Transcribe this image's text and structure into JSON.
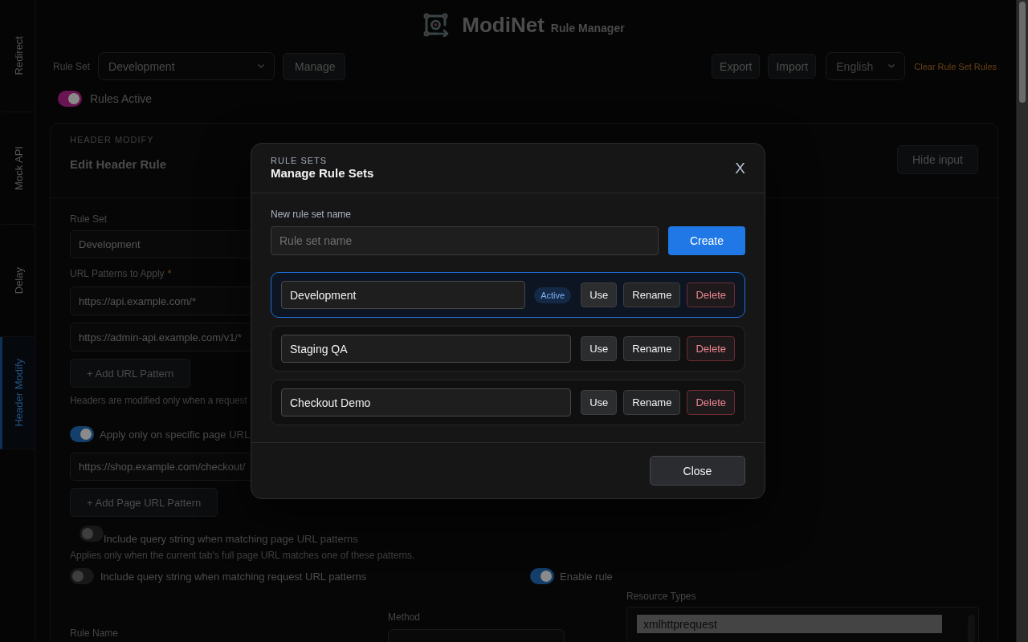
{
  "sidebar": {
    "tabs": [
      {
        "label": "Redirect",
        "selected": false
      },
      {
        "label": "Mock API",
        "selected": false
      },
      {
        "label": "Delay",
        "selected": false
      },
      {
        "label": "Header Modify",
        "selected": true
      }
    ]
  },
  "brand": {
    "title": "ModiNet",
    "subtitle": "Rule Manager"
  },
  "toolbar": {
    "rule_set_label": "Rule Set",
    "rule_set": "Development",
    "manage_button": "Manage",
    "export_button": "Export",
    "import_button": "Import",
    "language": "English",
    "clear_link": "Clear Rule Set Rules"
  },
  "rules_active": {
    "label": "Rules Active",
    "on": true
  },
  "editor": {
    "eyebrow": "HEADER MODIFY",
    "title": "Edit Header Rule",
    "hide_button": "Hide input",
    "rule_set": {
      "label": "Rule Set",
      "value": "Development"
    },
    "url_patterns": {
      "label": "URL Patterns to Apply",
      "required_mark": "*",
      "values": [
        "https://api.example.com/*",
        "https://admin-api.example.com/v1/*"
      ],
      "add_button": "+ Add URL Pattern",
      "note": "Headers are modified only when a request"
    },
    "page_filter": {
      "label": "Apply only on specific page URL",
      "on": true,
      "values": [
        "https://shop.example.com/checkout/"
      ],
      "add_button": "+ Add Page URL Pattern"
    },
    "page_query": {
      "label": "Include query string when matching page URL patterns",
      "on": false,
      "note": "Applies only when the current tab's full page URL matches one of these patterns."
    },
    "request_query": {
      "label": "Include query string when matching request URL patterns",
      "on": false
    },
    "enable_rule": {
      "label": "Enable rule",
      "on": true
    },
    "rule_name": {
      "label": "Rule Name"
    },
    "method": {
      "label": "Method"
    },
    "resource_types": {
      "label": "Resource Types",
      "options": [
        {
          "label": "xmlhttprequest",
          "selected": true
        }
      ]
    }
  },
  "modal": {
    "eyebrow": "RULE SETS",
    "title": "Manage Rule Sets",
    "close_button": "X",
    "new_name": {
      "label": "New rule set name",
      "placeholder": "Rule set name"
    },
    "create_button": "Create",
    "rule_sets": [
      {
        "name": "Development",
        "active": true,
        "badge": "Active",
        "actions": [
          {
            "label": "Use",
            "kind": "use"
          },
          {
            "label": "Rename",
            "kind": "rename"
          },
          {
            "label": "Delete",
            "kind": "delete"
          }
        ]
      },
      {
        "name": "Staging QA",
        "active": false,
        "actions": [
          {
            "label": "Use",
            "kind": "use"
          },
          {
            "label": "Rename",
            "kind": "rename"
          },
          {
            "label": "Delete",
            "kind": "delete"
          }
        ]
      },
      {
        "name": "Checkout Demo",
        "active": false,
        "actions": [
          {
            "label": "Use",
            "kind": "use"
          },
          {
            "label": "Rename",
            "kind": "rename"
          },
          {
            "label": "Delete",
            "kind": "delete"
          }
        ]
      }
    ],
    "done_button": "Close"
  }
}
